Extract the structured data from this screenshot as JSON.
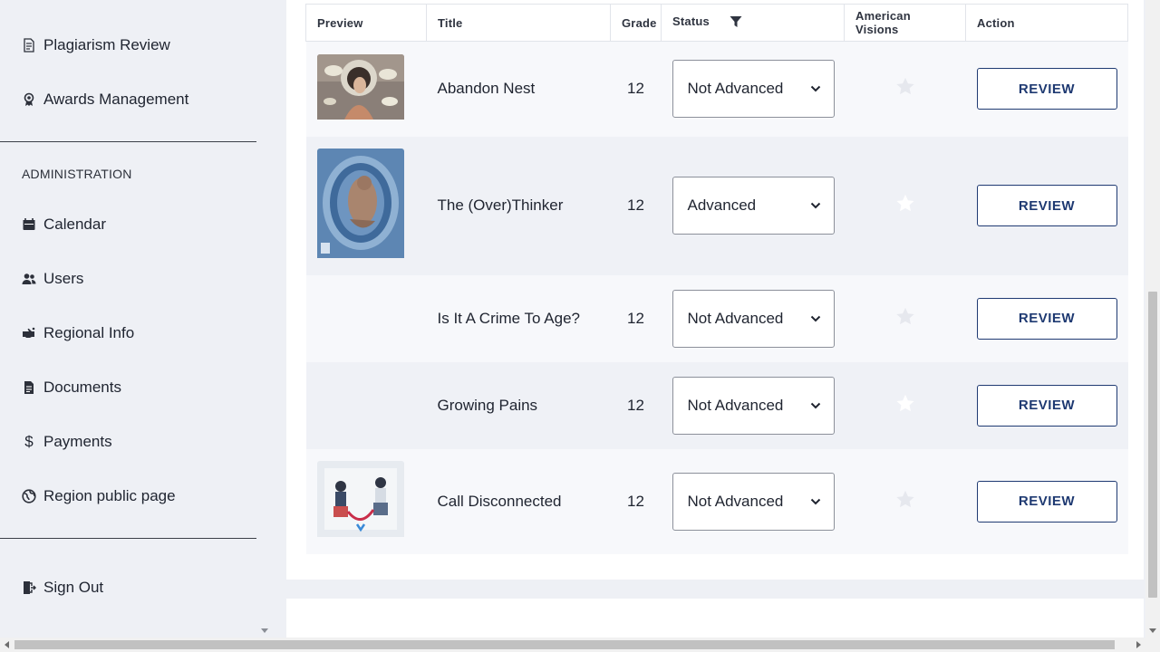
{
  "sidebar": {
    "items_top": [
      {
        "label": "Plagiarism Review",
        "icon": "document-search-icon"
      },
      {
        "label": "Awards Management",
        "icon": "award-ribbon-icon"
      }
    ],
    "admin_section_label": "ADMINISTRATION",
    "admin_items": [
      {
        "label": "Calendar",
        "icon": "calendar-icon"
      },
      {
        "label": "Users",
        "icon": "users-icon"
      },
      {
        "label": "Regional Info",
        "icon": "hand-point-icon"
      },
      {
        "label": "Documents",
        "icon": "document-icon"
      },
      {
        "label": "Payments",
        "icon": "dollar-icon"
      },
      {
        "label": "Region public page",
        "icon": "globe-icon"
      }
    ],
    "sign_out": {
      "label": "Sign Out",
      "icon": "sign-out-icon"
    }
  },
  "table": {
    "headers": {
      "preview": "Preview",
      "title": "Title",
      "grade": "Grade",
      "status": "Status",
      "american_visions": "American Visions",
      "action": "Action"
    },
    "rows": [
      {
        "title": "Abandon Nest",
        "grade": "12",
        "status": "Not Advanced",
        "american_visions": false,
        "action": "REVIEW",
        "has_preview": true
      },
      {
        "title": "The (Over)Thinker",
        "grade": "12",
        "status": "Advanced",
        "american_visions": false,
        "action": "REVIEW",
        "has_preview": true
      },
      {
        "title": "Is It A Crime To Age?",
        "grade": "12",
        "status": "Not Advanced",
        "american_visions": false,
        "action": "REVIEW",
        "has_preview": false
      },
      {
        "title": "Growing Pains",
        "grade": "12",
        "status": "Not Advanced",
        "american_visions": false,
        "action": "REVIEW",
        "has_preview": false
      },
      {
        "title": "Call Disconnected",
        "grade": "12",
        "status": "Not Advanced",
        "american_visions": false,
        "action": "REVIEW",
        "has_preview": true
      }
    ]
  },
  "colors": {
    "accent": "#1f3a72",
    "star_inactive": "#e6e8ee"
  }
}
